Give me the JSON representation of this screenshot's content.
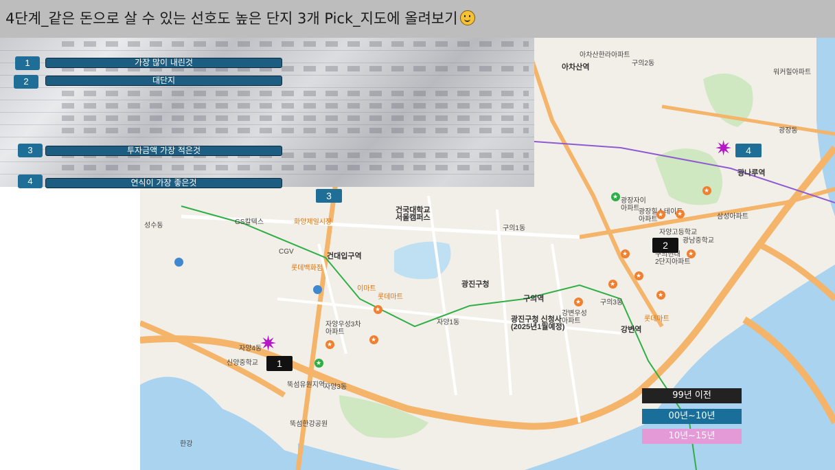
{
  "title": "4단계_같은 돈으로 살 수 있는 선호도 높은 단지 3개 Pick_지도에 올려보기",
  "criteria": [
    {
      "num": "1",
      "label": "가장 많이 내린것"
    },
    {
      "num": "2",
      "label": "대단지"
    },
    {
      "num": "3",
      "label": "투자금액 가장 적은것"
    },
    {
      "num": "4",
      "label": "연식이 가장 좋은것"
    }
  ],
  "map_markers": [
    {
      "num": "1"
    },
    {
      "num": "2"
    },
    {
      "num": "3"
    },
    {
      "num": "4"
    }
  ],
  "legend": [
    {
      "label": "99년 이전",
      "bg": "#222222",
      "fg": "#ffffff"
    },
    {
      "label": "00년~10년",
      "bg": "#1a6f9a",
      "fg": "#ffffff"
    },
    {
      "label": "10년~15년",
      "bg": "#e59ad8",
      "fg": "#ffffff"
    }
  ],
  "map_labels": {
    "hwayang": "화양제일시장",
    "konkuk": "건국대학교\n서울캠퍼스",
    "konkuk_station": "건대입구역",
    "gwangjin_gu": "광진구청",
    "gwangjin_office": "광진구청 신청사\n(2025년1월예정)",
    "guui": "구의역",
    "gangbyeon": "강변역",
    "achasan": "아차산역",
    "gwangnaru": "광나루역",
    "gwangjang": "광장동",
    "guui1": "구의1동",
    "guui2": "구의2동",
    "guui3": "구의3동",
    "jayang1": "자양1동",
    "jayang3": "자양3동",
    "jayang4": "자양4동",
    "seongsu": "성수동",
    "ttukseom": "뚝섬유원지역",
    "ttukseom_park": "뚝섬한강공원",
    "hangang": "한강",
    "cgv": "CGV",
    "lotte_mart": "롯데마트",
    "lotte_department": "롯데백화점",
    "emart": "이마트",
    "guui_lotte": "롯데마트",
    "gwangjang_hillstate": "광장힐스테이트\n아파트",
    "gwangjang_jai": "광장자이\n아파트",
    "hyundai": "구의현대\n2단지아파트",
    "gangbyeon_woosung": "강변우성\n아파트",
    "jayang_woosung": "자양우성3차\n아파트",
    "samsung": "삼성아파트",
    "wikeuhill": "워커힐아파트",
    "aca_apartment": "아차산한라아파트",
    "gs_the": "GS칼텍스",
    "sinyang": "신양중학교",
    "jayang_high": "자양고등학교",
    "gwangnam": "광남중학교"
  }
}
